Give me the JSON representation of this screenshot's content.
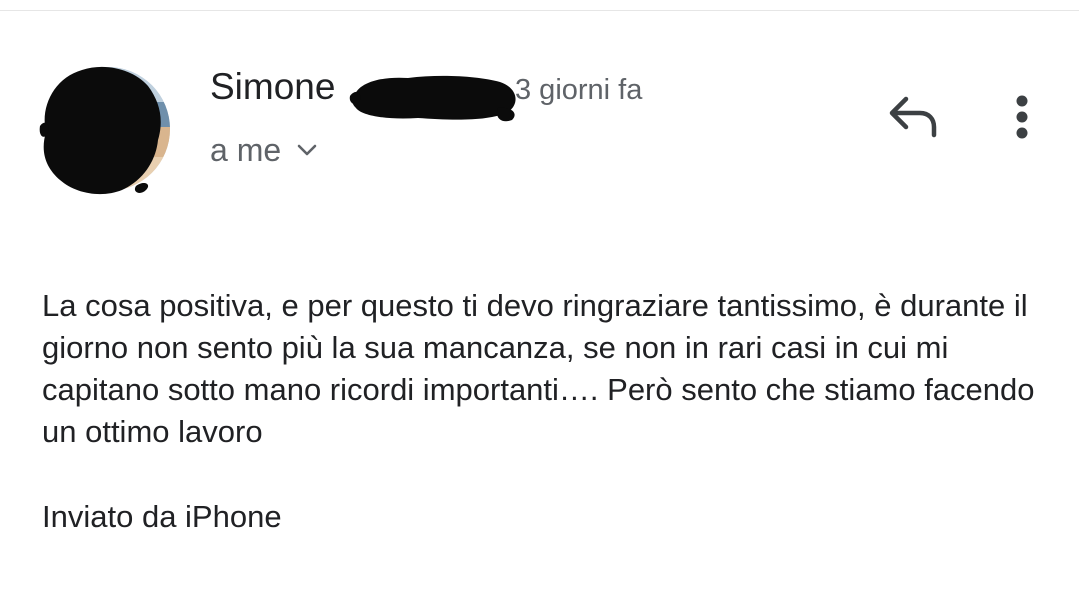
{
  "header": {
    "sender_name": "Simone",
    "time_ago": "3 giorni fa",
    "recipient_label": "a me",
    "chevron_icon": "chevron-down-icon",
    "reply_icon": "reply-icon",
    "more_icon": "more-vert-icon"
  },
  "message": {
    "body": "La cosa positiva, e per questo ti devo ringraziare tantissimo, è durante il giorno non sento più la sua mancanza, se non in rari casi in cui mi capitano sotto mano ricordi importanti…. Però sento che stiamo facendo un ottimo lavoro",
    "signature": "Inviato da iPhone"
  },
  "colors": {
    "primary_text": "#202124",
    "secondary_text": "#5f6368",
    "icon": "#3c4043"
  }
}
